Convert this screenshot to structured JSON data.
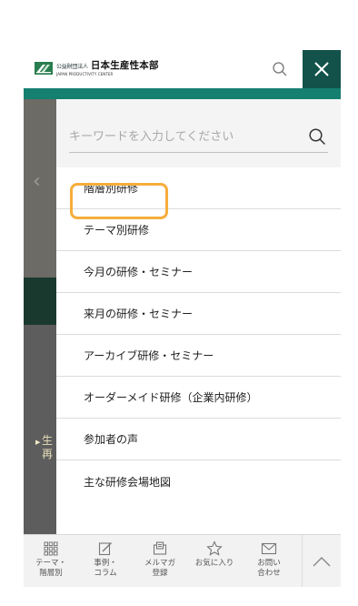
{
  "header": {
    "logo_prefix": "公益財団法人",
    "logo_name": "日本生産性本部",
    "logo_en": "JAPAN PRODUCTIVITY CENTER",
    "search_icon": "search-icon",
    "close_icon": "close-icon"
  },
  "background_page": {
    "text_line1": "生",
    "text_line2": "再"
  },
  "search": {
    "placeholder": "キーワードを入力してください",
    "value": ""
  },
  "menu": {
    "items": [
      {
        "label": "階層別研修"
      },
      {
        "label": "テーマ別研修"
      },
      {
        "label": "今月の研修・セミナー"
      },
      {
        "label": "来月の研修・セミナー"
      },
      {
        "label": "アーカイブ研修・セミナー"
      },
      {
        "label": "オーダーメイド研修（企業内研修）"
      },
      {
        "label": "参加者の声"
      },
      {
        "label": "主な研修会場地図"
      }
    ],
    "focused_item": "テーマ別研修"
  },
  "bottom_nav": {
    "items": [
      {
        "line1": "テーマ・",
        "line2": "階層別",
        "icon": "grid-icon"
      },
      {
        "line1": "事例・",
        "line2": "コラム",
        "icon": "edit-icon"
      },
      {
        "line1": "メルマガ",
        "line2": "登録",
        "icon": "mail-register-icon"
      },
      {
        "line1": "お気に入り",
        "line2": "",
        "icon": "star-icon"
      },
      {
        "line1": "お問い",
        "line2": "合わせ",
        "icon": "mail-icon"
      }
    ],
    "top_icon": "chevron-up-icon"
  },
  "colors": {
    "brand_dark": "#12524a",
    "brand_teal": "#15806f",
    "focus_ring": "#f6ad3b"
  }
}
